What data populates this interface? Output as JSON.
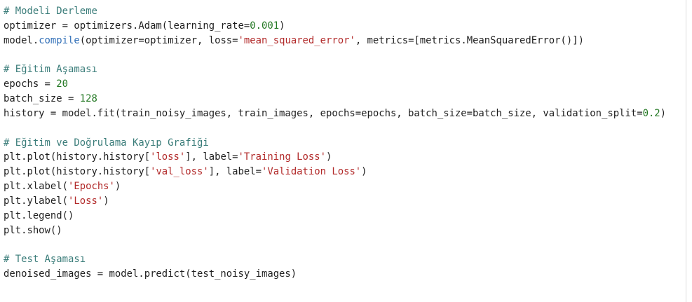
{
  "colors": {
    "background": "#ffffff",
    "text": "#1f1f1f",
    "comment": "#3b7d7a",
    "string": "#b22a2a",
    "number": "#227722",
    "method": "#3270b8",
    "divider": "#dcdcdc"
  },
  "code_lines": [
    [
      {
        "t": "comment",
        "v": "# Modeli Derleme"
      }
    ],
    [
      {
        "t": "plain",
        "v": "optimizer = optimizers.Adam(learning_rate="
      },
      {
        "t": "number",
        "v": "0.001"
      },
      {
        "t": "plain",
        "v": ")"
      }
    ],
    [
      {
        "t": "plain",
        "v": "model."
      },
      {
        "t": "method",
        "v": "compile"
      },
      {
        "t": "plain",
        "v": "(optimizer=optimizer, loss="
      },
      {
        "t": "string",
        "v": "'mean_squared_error'"
      },
      {
        "t": "plain",
        "v": ", metrics=[metrics.MeanSquaredError()])"
      }
    ],
    [],
    [
      {
        "t": "comment",
        "v": "# Eğitim Aşaması"
      }
    ],
    [
      {
        "t": "plain",
        "v": "epochs = "
      },
      {
        "t": "number",
        "v": "20"
      }
    ],
    [
      {
        "t": "plain",
        "v": "batch_size = "
      },
      {
        "t": "number",
        "v": "128"
      }
    ],
    [
      {
        "t": "plain",
        "v": "history = model.fit(train_noisy_images, train_images, epochs=epochs, batch_size=batch_size, validation_split="
      },
      {
        "t": "number",
        "v": "0.2"
      },
      {
        "t": "plain",
        "v": ")"
      }
    ],
    [],
    [
      {
        "t": "comment",
        "v": "# Eğitim ve Doğrulama Kayıp Grafiği"
      }
    ],
    [
      {
        "t": "plain",
        "v": "plt.plot(history.history["
      },
      {
        "t": "string",
        "v": "'loss'"
      },
      {
        "t": "plain",
        "v": "], label="
      },
      {
        "t": "string",
        "v": "'Training Loss'"
      },
      {
        "t": "plain",
        "v": ")"
      }
    ],
    [
      {
        "t": "plain",
        "v": "plt.plot(history.history["
      },
      {
        "t": "string",
        "v": "'val_loss'"
      },
      {
        "t": "plain",
        "v": "], label="
      },
      {
        "t": "string",
        "v": "'Validation Loss'"
      },
      {
        "t": "plain",
        "v": ")"
      }
    ],
    [
      {
        "t": "plain",
        "v": "plt.xlabel("
      },
      {
        "t": "string",
        "v": "'Epochs'"
      },
      {
        "t": "plain",
        "v": ")"
      }
    ],
    [
      {
        "t": "plain",
        "v": "plt.ylabel("
      },
      {
        "t": "string",
        "v": "'Loss'"
      },
      {
        "t": "plain",
        "v": ")"
      }
    ],
    [
      {
        "t": "plain",
        "v": "plt.legend()"
      }
    ],
    [
      {
        "t": "plain",
        "v": "plt.show()"
      }
    ],
    [],
    [
      {
        "t": "comment",
        "v": "# Test Aşaması"
      }
    ],
    [
      {
        "t": "plain",
        "v": "denoised_images = model.predict(test_noisy_images)"
      }
    ]
  ]
}
